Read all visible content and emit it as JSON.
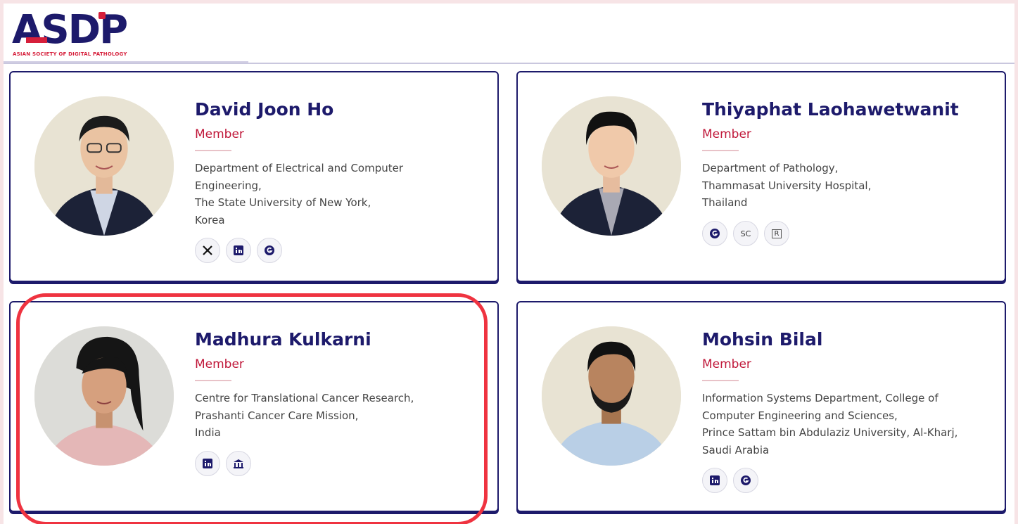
{
  "header": {
    "logo_text": "ASDP",
    "logo_subtitle": "ASIAN SOCIETY OF DIGITAL PATHOLOGY"
  },
  "members": [
    {
      "name": "David Joon Ho",
      "role": "Member",
      "affiliation": [
        "Department of Electrical and Computer",
        "Engineering,",
        "The State University of New York,",
        "Korea"
      ],
      "links": [
        "x-icon",
        "linkedin-icon",
        "researchgate-icon"
      ]
    },
    {
      "name": "Thiyaphat Laohawetwanit",
      "role": "Member",
      "affiliation": [
        "Department of Pathology,",
        "Thammasat University Hospital,",
        "Thailand"
      ],
      "links": [
        "researchgate-icon",
        "scopus-icon",
        "researcherid-icon"
      ],
      "scopus_label": "SC",
      "rid_label": "R"
    },
    {
      "name": "Madhura Kulkarni",
      "role": "Member",
      "affiliation": [
        "Centre for Translational Cancer Research,",
        "Prashanti Cancer Care Mission,",
        "India"
      ],
      "links": [
        "linkedin-icon",
        "institution-icon"
      ]
    },
    {
      "name": "Mohsin Bilal",
      "role": "Member",
      "affiliation": [
        "Information Systems Department, College of",
        "Computer Engineering and Sciences,",
        "Prince Sattam bin Abdulaziz University, Al-Kharj,",
        "Saudi Arabia"
      ],
      "links": [
        "linkedin-icon",
        "researchgate-icon"
      ]
    }
  ],
  "colors": {
    "brand_navy": "#1d1a6b",
    "role_red": "#c0183a",
    "highlight_red": "#ef3340"
  }
}
